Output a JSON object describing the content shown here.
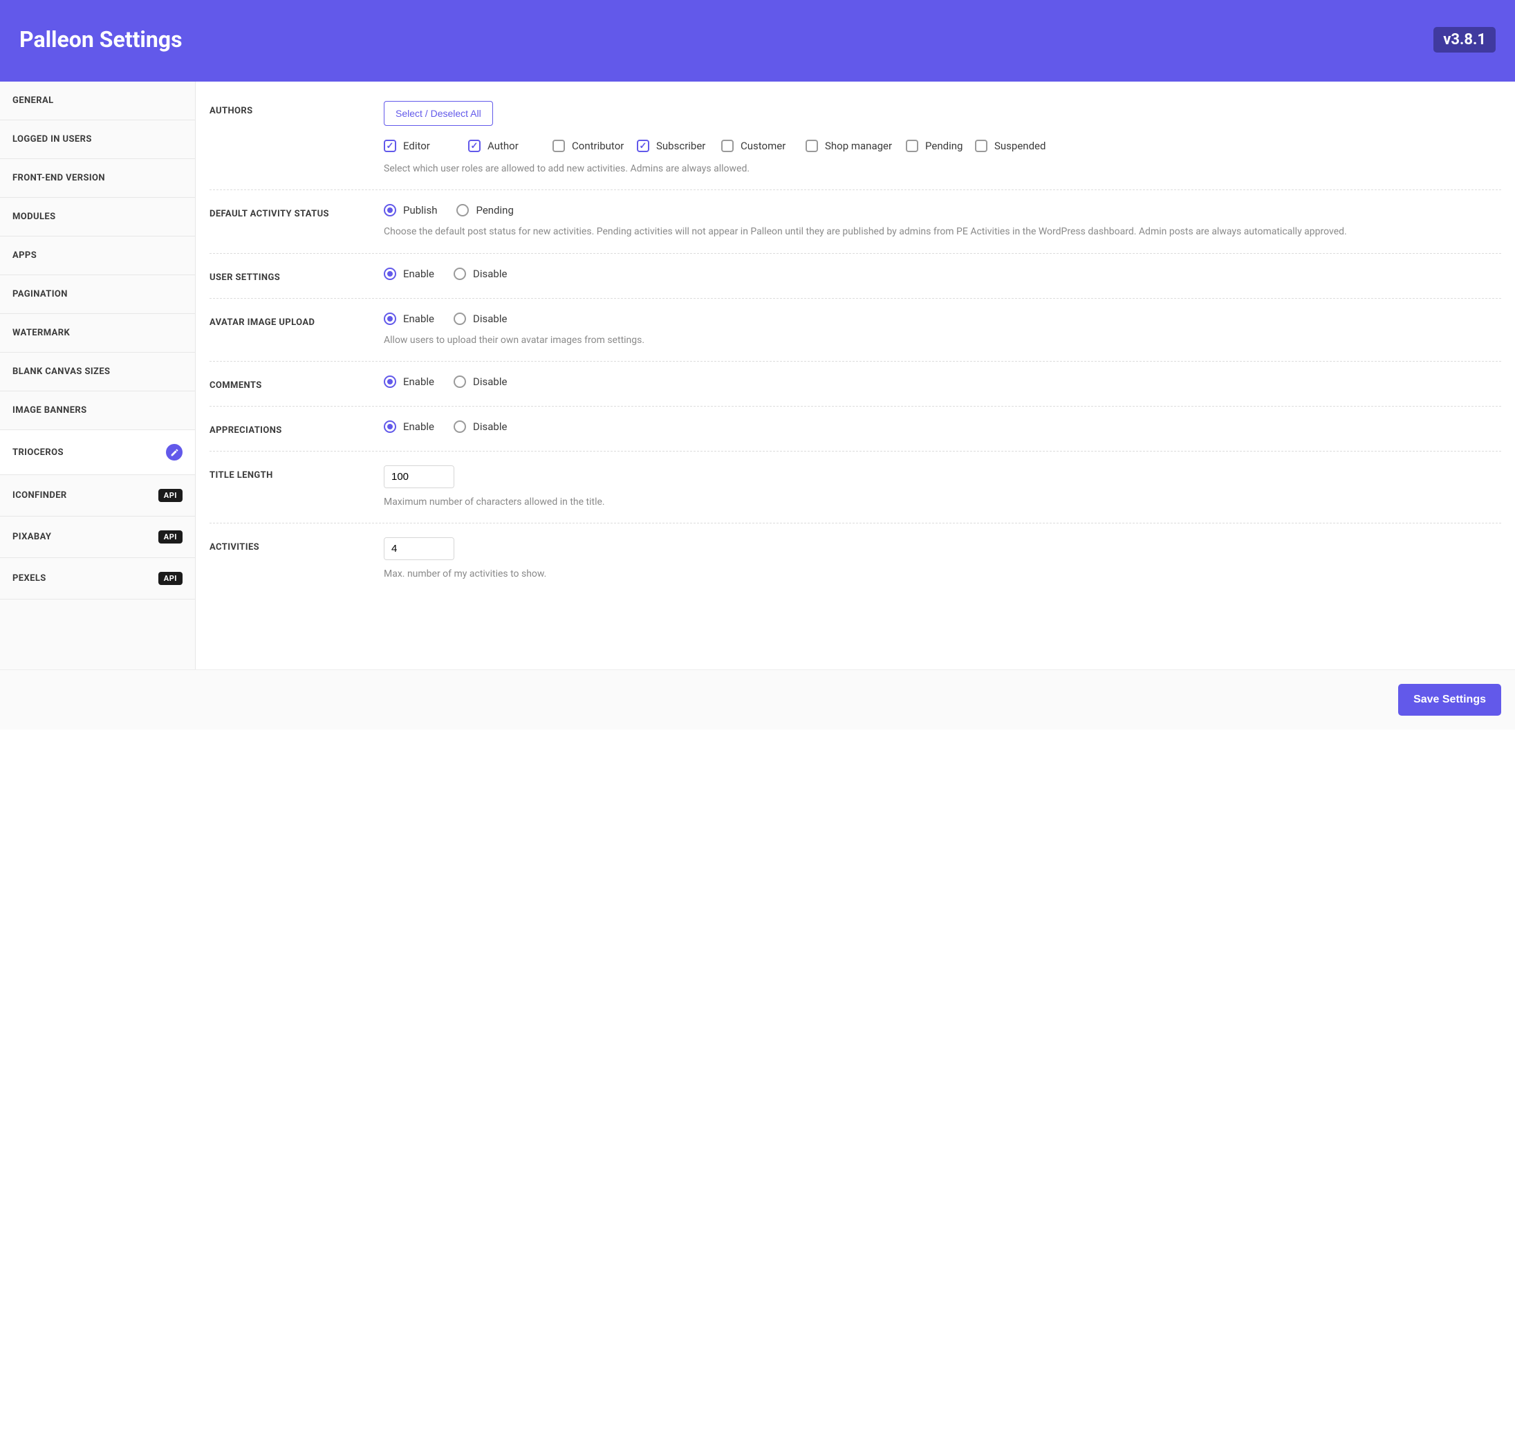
{
  "header": {
    "title": "Palleon Settings",
    "version": "v3.8.1"
  },
  "sidebar": {
    "items": [
      {
        "label": "GENERAL",
        "active": false
      },
      {
        "label": "LOGGED IN USERS",
        "active": false
      },
      {
        "label": "FRONT-END VERSION",
        "active": false
      },
      {
        "label": "MODULES",
        "active": false
      },
      {
        "label": "APPS",
        "active": false
      },
      {
        "label": "PAGINATION",
        "active": false
      },
      {
        "label": "WATERMARK",
        "active": false
      },
      {
        "label": "BLANK CANVAS SIZES",
        "active": false
      },
      {
        "label": "IMAGE BANNERS",
        "active": false
      },
      {
        "label": "TRIOCEROS",
        "active": true,
        "badge": "icon"
      },
      {
        "label": "ICONFINDER",
        "active": false,
        "badge": "API"
      },
      {
        "label": "PIXABAY",
        "active": false,
        "badge": "API"
      },
      {
        "label": "PEXELS",
        "active": false,
        "badge": "API"
      }
    ]
  },
  "settings": {
    "authors": {
      "label": "AUTHORS",
      "selectAllBtn": "Select / Deselect All",
      "roles": [
        {
          "name": "Editor",
          "checked": true
        },
        {
          "name": "Author",
          "checked": true
        },
        {
          "name": "Contributor",
          "checked": false
        },
        {
          "name": "Subscriber",
          "checked": true
        },
        {
          "name": "Customer",
          "checked": false
        },
        {
          "name": "Shop manager",
          "checked": false
        },
        {
          "name": "Pending",
          "checked": false
        },
        {
          "name": "Suspended",
          "checked": false
        }
      ],
      "help": "Select which user roles are allowed to add new activities. Admins are always allowed."
    },
    "defaultStatus": {
      "label": "DEFAULT ACTIVITY STATUS",
      "options": [
        {
          "name": "Publish",
          "selected": true
        },
        {
          "name": "Pending",
          "selected": false
        }
      ],
      "help": "Choose the default post status for new activities. Pending activities will not appear in Palleon until they are published by admins from PE Activities in the WordPress dashboard. Admin posts are always automatically approved."
    },
    "userSettings": {
      "label": "USER SETTINGS",
      "options": [
        {
          "name": "Enable",
          "selected": true
        },
        {
          "name": "Disable",
          "selected": false
        }
      ]
    },
    "avatar": {
      "label": "AVATAR IMAGE UPLOAD",
      "options": [
        {
          "name": "Enable",
          "selected": true
        },
        {
          "name": "Disable",
          "selected": false
        }
      ],
      "help": "Allow users to upload their own avatar images from settings."
    },
    "comments": {
      "label": "COMMENTS",
      "options": [
        {
          "name": "Enable",
          "selected": true
        },
        {
          "name": "Disable",
          "selected": false
        }
      ]
    },
    "appreciations": {
      "label": "APPRECIATIONS",
      "options": [
        {
          "name": "Enable",
          "selected": true
        },
        {
          "name": "Disable",
          "selected": false
        }
      ]
    },
    "titleLength": {
      "label": "TITLE LENGTH",
      "value": "100",
      "help": "Maximum number of characters allowed in the title."
    },
    "activities": {
      "label": "ACTIVITIES",
      "value": "4",
      "help": "Max. number of my activities to show."
    }
  },
  "footer": {
    "saveBtn": "Save Settings"
  }
}
